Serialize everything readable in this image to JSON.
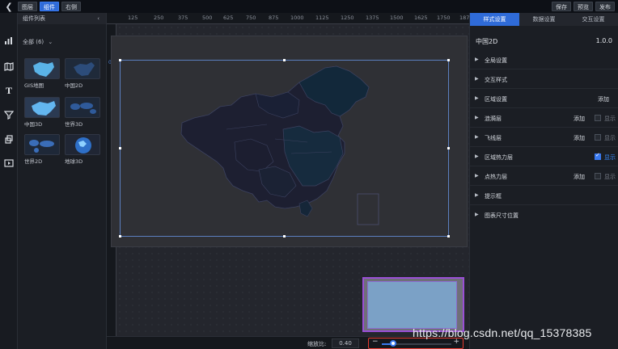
{
  "topbar": {
    "layers_label": "图层",
    "components_label": "组件",
    "right_label": "右侧",
    "save_label": "保存",
    "preview_label": "预览",
    "publish_label": "发布"
  },
  "component_panel": {
    "title": "组件列表",
    "filter_label": "全部 (6)",
    "items": [
      {
        "label": "GIS地图"
      },
      {
        "label": "中国2D"
      },
      {
        "label": "中国3D"
      },
      {
        "label": "世界3D"
      },
      {
        "label": "世界2D"
      },
      {
        "label": "地球3D"
      }
    ]
  },
  "ruler": {
    "ticks": [
      "125",
      "250",
      "375",
      "500",
      "625",
      "750",
      "875",
      "1000",
      "1125",
      "1250",
      "1375",
      "1500",
      "1625",
      "1750",
      "187"
    ],
    "left_marker": "0"
  },
  "zoom": {
    "label": "缩放比:",
    "value": "0.40",
    "minus": "−",
    "plus": "+",
    "level": 0.16
  },
  "right_panel": {
    "tabs": [
      "样式设置",
      "数据设置",
      "交互设置"
    ],
    "title": "中国2D",
    "version": "1.0.0",
    "rows": [
      {
        "name": "全局设置",
        "add": "",
        "checked": null,
        "show": ""
      },
      {
        "name": "交互样式",
        "add": "",
        "checked": null,
        "show": ""
      },
      {
        "name": "区域设置",
        "add": "添加",
        "checked": null,
        "show": ""
      },
      {
        "name": "涟漪层",
        "add": "添加",
        "checked": false,
        "show": "显示"
      },
      {
        "name": "飞线层",
        "add": "添加",
        "checked": false,
        "show": "显示"
      },
      {
        "name": "区域热力层",
        "add": "",
        "checked": true,
        "show": "显示"
      },
      {
        "name": "点热力层",
        "add": "添加",
        "checked": false,
        "show": "显示"
      },
      {
        "name": "提示框",
        "add": "",
        "checked": null,
        "show": ""
      },
      {
        "name": "图表尺寸位置",
        "add": "",
        "checked": null,
        "show": ""
      }
    ]
  },
  "watermark": "https://blog.csdn.net/qq_15378385",
  "colors": {
    "accent": "#2f6bd8",
    "highlight_border": "#e53a2f",
    "minimap_border": "#9a4fd6"
  }
}
